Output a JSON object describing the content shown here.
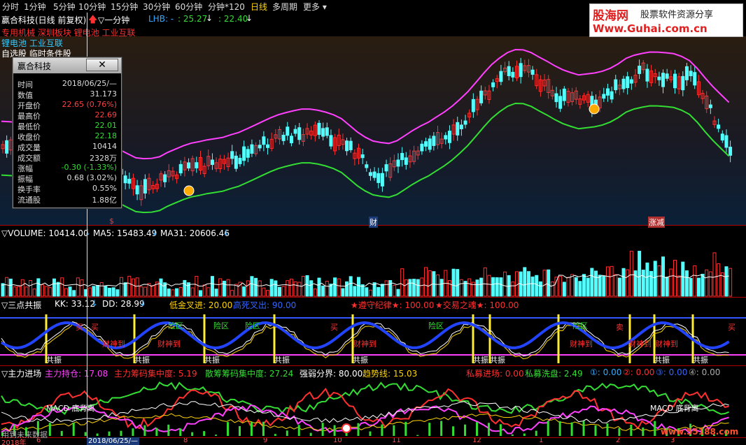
{
  "toolbar": {
    "tabs": [
      "分时",
      "1分钟",
      "5分钟",
      "10分钟",
      "15分钟",
      "30分钟",
      "60分钟",
      "分钟*120",
      "日线",
      "多周期",
      "更多"
    ],
    "selected": "日线"
  },
  "header": {
    "stock": "赢合科技(日线 前复权)",
    "indicator": "▽一分钟",
    "lhb_label": "LHB: -",
    "lhb_v1": ": 25.27",
    "lhb_v2": ": 22.40"
  },
  "sectors": {
    "line1": "专用机械 深圳板块 锂电池 工业互联",
    "line2": "锂电池 工业互联",
    "line3": "自选股 临时条件股"
  },
  "infobox": {
    "title": "赢合科技",
    "close": "✕",
    "rows": [
      {
        "k": "时间",
        "v": "2018/06/25/—",
        "c": "#ddd"
      },
      {
        "k": "数值",
        "v": "31.173",
        "c": "#ddd"
      },
      {
        "k": "开盘价",
        "v": "22.65 (0.76%)",
        "c": "#ff4040"
      },
      {
        "k": "最高价",
        "v": "22.69",
        "c": "#ff4040"
      },
      {
        "k": "最低价",
        "v": "22.01",
        "c": "#33dd33"
      },
      {
        "k": "收盘价",
        "v": "22.18",
        "c": "#33dd33"
      },
      {
        "k": "成交量",
        "v": "10414",
        "c": "#ddd"
      },
      {
        "k": "成交额",
        "v": "2328万",
        "c": "#ddd"
      },
      {
        "k": "涨幅",
        "v": "-0.30 (-1.33%)",
        "c": "#33dd33"
      },
      {
        "k": "振幅",
        "v": "0.68 (3.02%)",
        "c": "#ddd"
      },
      {
        "k": "换手率",
        "v": "0.55%",
        "c": "#ddd"
      },
      {
        "k": "流通股",
        "v": "1.88亿",
        "c": "#ddd"
      }
    ]
  },
  "main_markers": {
    "m1": "$",
    "m2": "财",
    "m3": "涨减"
  },
  "volume": {
    "label": "▽VOLUME: 10414.00",
    "ma5": "MA5: 15483.49",
    "ma31": "MA31: 20606.46"
  },
  "sandian": {
    "title": "▽三点共振",
    "kk": "KK: 33.12",
    "dd": "DD: 28.99",
    "dijin": "低金叉进: 20.00",
    "gaosi": "高死叉出: 90.00",
    "zunshou": "★遵守纪律★: 100.00",
    "jiaoyi": "★交易之魂★: 100.00",
    "marks": [
      "买",
      "买",
      "买",
      "买",
      "险区",
      "险区",
      "险区",
      "险区",
      "险区",
      "财神到",
      "财神到",
      "财神到",
      "财神到",
      "财神到",
      "财神到",
      "卖"
    ],
    "gongzhen": "共振"
  },
  "zhuli": {
    "title": "▽主力进场",
    "chicang": "主力持仓: 17.08",
    "choumajizhong": "主力筹码集中度: 5.19",
    "sanhu": "散筹筹码集中度: 27.24",
    "qiangruo": "强弱分界: 80.00",
    "qushi": "趋势线: 15.03",
    "siyong": "私募进场: 0.00",
    "simuxipan": "私募洗盘: 2.49",
    "c1": "①: 0.00",
    "c2": "②: 0.00",
    "c3": "③: 0.00",
    "c4": "④: 0.00",
    "macd1": "MACD 底背离",
    "macd2": "MACD 底背离"
  },
  "bottom": {
    "note": "用到未来数据",
    "date": "2018/06/25/—",
    "ticks": [
      "2018年",
      "6",
      "8",
      "9",
      "10",
      "11",
      "12",
      "1",
      "2",
      "3"
    ]
  },
  "logo": {
    "brand": "股海网",
    "slogan": "股票软件资源分享",
    "url": "Www.Guhai.com.cn"
  },
  "watermark": "www.55188.com",
  "colors": {
    "up": "#ff3030",
    "down": "#54ffff",
    "green": "#33dd33",
    "magenta": "#ff40ff",
    "yellow": "#ffd400"
  }
}
